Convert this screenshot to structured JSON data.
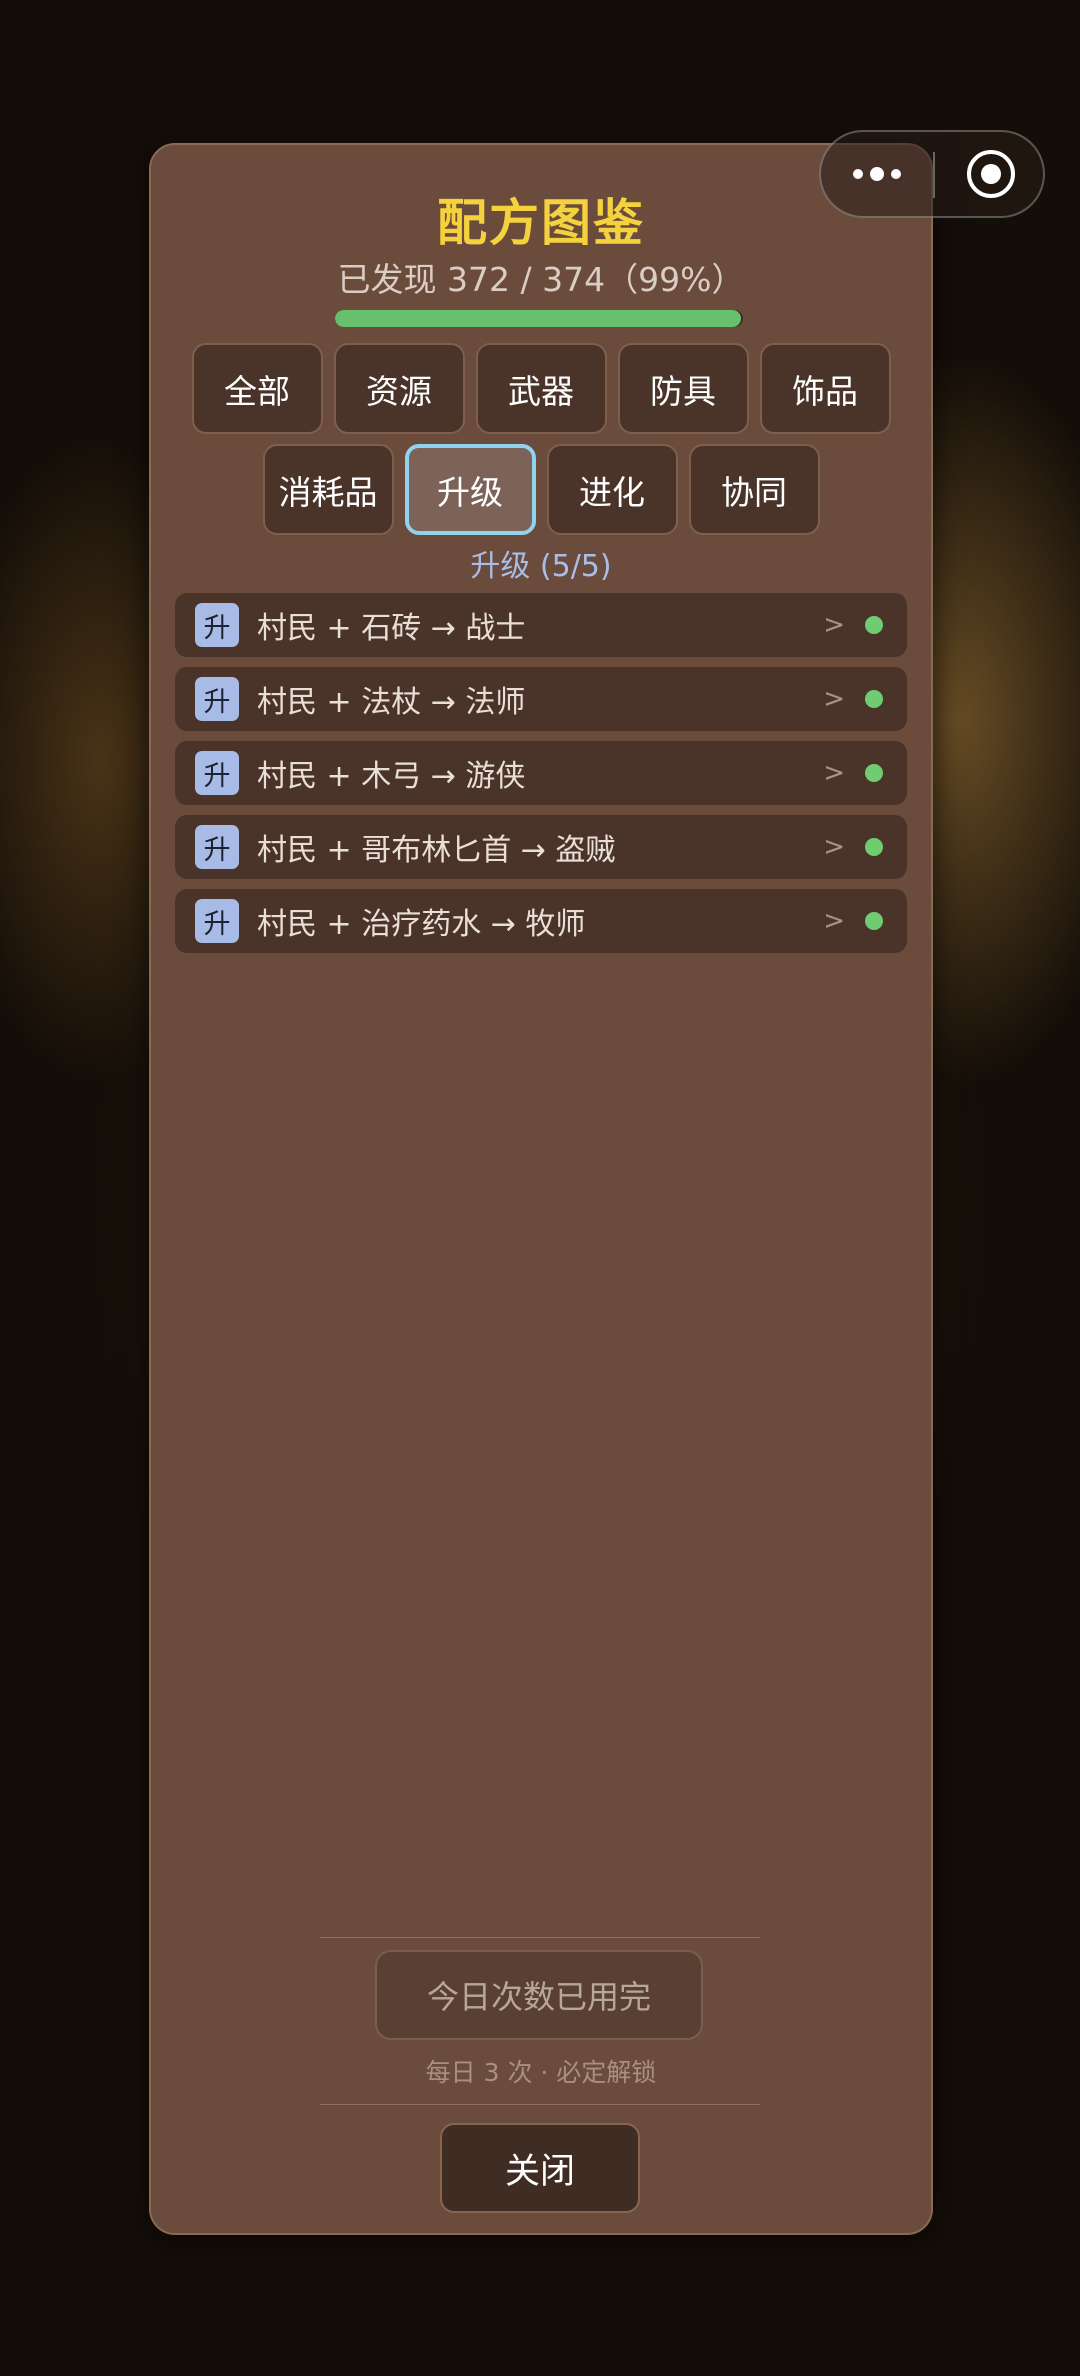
{
  "panel": {
    "title": "配方图鉴",
    "progress_text": "已发现 372 / 374（99%）",
    "progress_fraction": 0.995
  },
  "tabs_row1": [
    "全部",
    "资源",
    "武器",
    "防具",
    "饰品"
  ],
  "tabs_row2": [
    "消耗品",
    "升级",
    "进化",
    "协同"
  ],
  "active_tab": "升级",
  "section_label": "升级 (5/5)",
  "recipes": [
    {
      "badge": "升",
      "text": "村民 + 石砖 → 战士",
      "chevron": ">"
    },
    {
      "badge": "升",
      "text": "村民 + 法杖 → 法师",
      "chevron": ">"
    },
    {
      "badge": "升",
      "text": "村民 + 木弓 → 游侠",
      "chevron": ">"
    },
    {
      "badge": "升",
      "text": "村民 + 哥布林匕首 → 盗贼",
      "chevron": ">"
    },
    {
      "badge": "升",
      "text": "村民 + 治疗药水 → 牧师",
      "chevron": ">"
    }
  ],
  "quota_button": "今日次数已用完",
  "quota_note": "每日 3 次 · 必定解锁",
  "close_button": "关闭",
  "colors": {
    "title": "#f4d23e",
    "progress": "#67c16c",
    "status_dot": "#6fcc70",
    "active_tab_border": "#8fd3ef",
    "badge": "#a7bbe6"
  },
  "icons": {
    "capsule_menu": "more-dots-icon",
    "capsule_close": "target-circle-icon"
  }
}
